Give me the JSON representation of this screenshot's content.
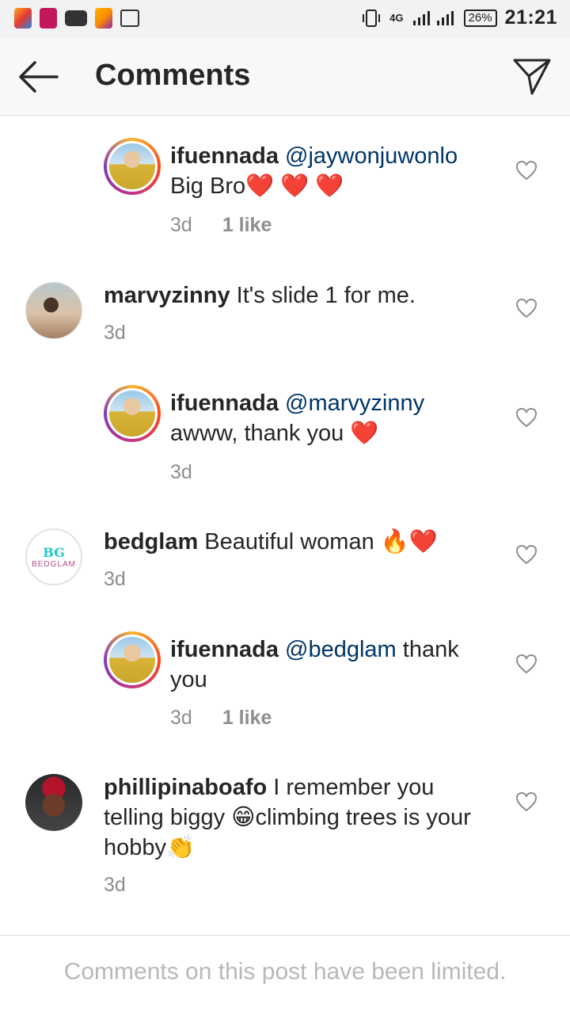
{
  "status_bar": {
    "network": "4G",
    "battery": "26%",
    "time": "21:21"
  },
  "header": {
    "title": "Comments"
  },
  "comments": [
    {
      "username": "ifuennada",
      "mention": "@jaywonjuwonlo",
      "text": " Big Bro❤️ ❤️ ❤️",
      "time": "3d",
      "likes": "1 like",
      "reply": true
    },
    {
      "username": "marvyzinny",
      "mention": "",
      "text": " It's slide 1 for me.",
      "time": "3d",
      "likes": "",
      "reply": false
    },
    {
      "username": "ifuennada",
      "mention": "@marvyzinny",
      "text": " awww, thank you ❤️",
      "time": "3d",
      "likes": "",
      "reply": true
    },
    {
      "username": "bedglam",
      "mention": "",
      "text": " Beautiful woman 🔥❤️",
      "time": "3d",
      "likes": "",
      "reply": false
    },
    {
      "username": "ifuennada",
      "mention": "@bedglam",
      "text": " thank you",
      "time": "3d",
      "likes": "1 like",
      "reply": true
    },
    {
      "username": "phillipinaboafo",
      "mention": "",
      "text": " I remember you telling biggy 😁climbing trees is your hobby👏",
      "time": "3d",
      "likes": "",
      "reply": false
    }
  ],
  "bedglam_logo": {
    "mark": "BG",
    "wordmark": "BEDGLAM"
  },
  "footer": {
    "notice": "Comments on this post have been limited."
  },
  "colors": {
    "mention": "#003569",
    "heart": "#e8538f",
    "meta": "#8e8e8e"
  }
}
